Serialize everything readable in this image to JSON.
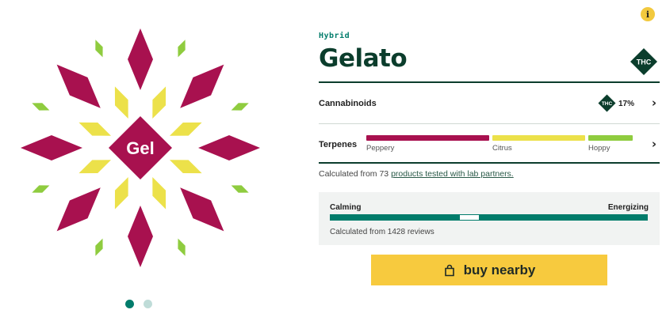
{
  "strain": {
    "type": "Hybrid",
    "name": "Gelato",
    "abbreviation": "Gel",
    "badge": "THC"
  },
  "colors": {
    "primary_shape": "#a8114f",
    "secondary_shape": "#ece14a",
    "tertiary_shape": "#8fcc3f",
    "brand_green": "#017c6b",
    "dark_green": "#0b3d2c",
    "cta_yellow": "#f7ca3e"
  },
  "carousel": {
    "active_index": 0,
    "count": 2
  },
  "cannabinoids": {
    "label": "Cannabinoids",
    "badge": "THC",
    "value": "17%"
  },
  "terpenes": {
    "label": "Terpenes",
    "items": [
      {
        "name": "Peppery",
        "color": "#a8114f",
        "share": 0.42
      },
      {
        "name": "Citrus",
        "color": "#ece14a",
        "share": 0.32
      },
      {
        "name": "Hoppy",
        "color": "#8fcc3f",
        "share": 0.16
      }
    ]
  },
  "calculation": {
    "prefix": "Calculated from 73",
    "link_text": "products tested with lab partners."
  },
  "effects": {
    "left_label": "Calming",
    "right_label": "Energizing",
    "position": 0.44,
    "reviews_text": "Calculated from 1428 reviews"
  },
  "cta": {
    "label": "buy nearby"
  },
  "info_icon": "i"
}
